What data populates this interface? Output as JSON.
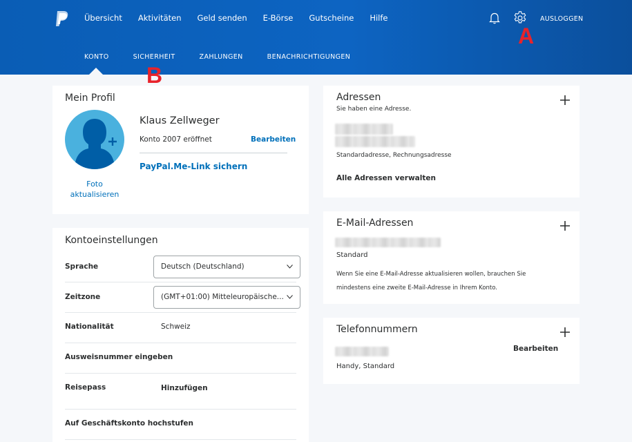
{
  "nav": {
    "items": [
      "Übersicht",
      "Aktivitäten",
      "Geld senden",
      "E-Börse",
      "Gutscheine",
      "Hilfe"
    ],
    "logout": "AUSLOGGEN"
  },
  "subnav": {
    "items": [
      "KONTO",
      "SICHERHEIT",
      "ZAHLUNGEN",
      "BENACHRICHTIGUNGEN"
    ],
    "active": "KONTO"
  },
  "annotations": {
    "a": "A",
    "b": "B"
  },
  "profile": {
    "title": "Mein Profil",
    "name": "Klaus Zellweger",
    "opened": "Konto 2007 eröffnet",
    "edit": "Bearbeiten",
    "paypal_me": "PayPal.Me-Link sichern",
    "photo_line1": "Foto",
    "photo_line2": "aktualisieren"
  },
  "settings": {
    "title": "Kontoeinstellungen",
    "language_label": "Sprache",
    "language_value": "Deutsch (Deutschland)",
    "timezone_label": "Zeitzone",
    "timezone_value": "(GMT+01:00) Mitteleuropäische...",
    "nationality_label": "Nationalität",
    "nationality_value": "Schweiz",
    "id_link": "Ausweisnummer eingeben",
    "passport_label": "Reisepass",
    "passport_link": "Hinzufügen",
    "upgrade_link": "Auf Geschäftskonto hochstufen"
  },
  "addresses": {
    "title": "Adressen",
    "subtitle": "Sie haben eine Adresse.",
    "type": "Standardadresse, Rechnungsadresse",
    "manage": "Alle Adressen verwalten"
  },
  "emails": {
    "title": "E-Mail-Adressen",
    "status": "Standard",
    "note": "Wenn Sie eine E-Mail-Adresse aktualisieren wollen, brauchen Sie mindestens eine zweite E-Mail-Adresse in Ihrem Konto."
  },
  "phones": {
    "title": "Telefonnummern",
    "edit": "Bearbeiten",
    "type": "Handy, Standard"
  },
  "colors": {
    "brand_blue": "#0070ba",
    "header_blue": "#0d64c2",
    "annotation_red": "#e8232b",
    "avatar_blue": "#4ab1de"
  },
  "icons": [
    "paypal-logo-icon",
    "bell-icon",
    "gear-icon",
    "chevron-down-icon",
    "plus-icon"
  ]
}
